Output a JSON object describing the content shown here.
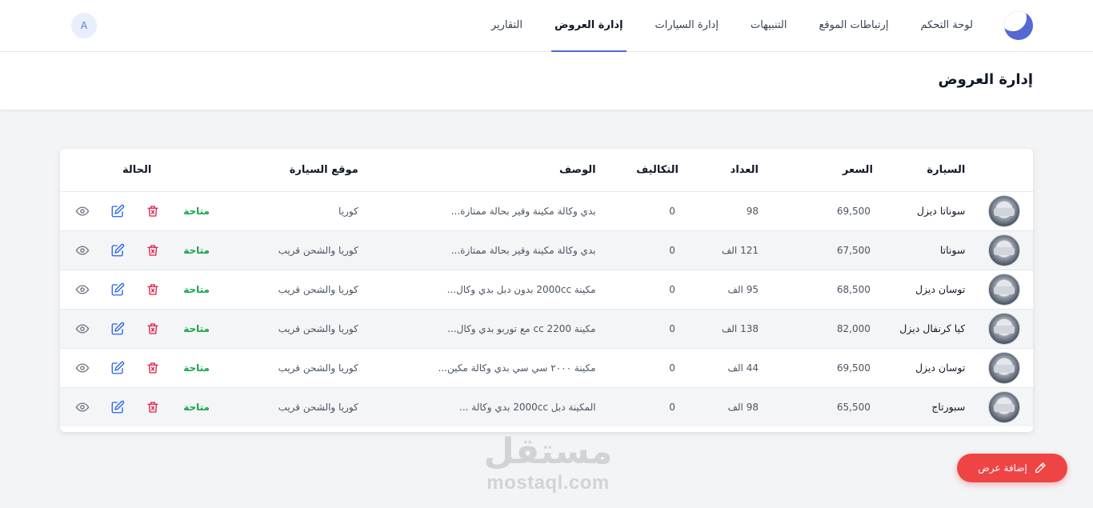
{
  "nav": {
    "items": [
      {
        "label": "لوحة التحكم",
        "active": false
      },
      {
        "label": "إرتباطات الموقع",
        "active": false
      },
      {
        "label": "التنبيهات",
        "active": false
      },
      {
        "label": "إدارة السيارات",
        "active": false
      },
      {
        "label": "إدارة العروض",
        "active": true
      },
      {
        "label": "التقارير",
        "active": false
      }
    ],
    "user_initial": "A",
    "logo_icon": "brand-logo-icon",
    "accent_color": "#5469d4"
  },
  "page": {
    "title": "إدارة العروض"
  },
  "table": {
    "headers": {
      "car": "السيارة",
      "price": "السعر",
      "odometer": "العداد",
      "costs": "التكاليف",
      "description": "الوصف",
      "location": "موقع السيارة",
      "status": "الحالة"
    },
    "rows": [
      {
        "car": "سوناتا ديزل",
        "price": "69,500",
        "odometer": "98",
        "costs": "0",
        "description": "بدي وكالة مكينة وقير بحالة ممتازة...",
        "location": "كوريا",
        "status": "متاحة"
      },
      {
        "car": "سوناتا",
        "price": "67,500",
        "odometer": "121 الف",
        "costs": "0",
        "description": "بدي وكالة مكينة وقير بحالة ممتازة...",
        "location": "كوريا والشحن قريب",
        "status": "متاحة"
      },
      {
        "car": "توسان ديزل",
        "price": "68,500",
        "odometer": "95 الف",
        "costs": "0",
        "description": "مكينة 2000cc بدون دبل بدي وكال...",
        "location": "كوريا والشحن قريب",
        "status": "متاحة"
      },
      {
        "car": "كيا كرنفال ديزل",
        "price": "82,000",
        "odometer": "138 الف",
        "costs": "0",
        "description": "مكينة 2200 cc مع توربو بدي وكال...",
        "location": "كوريا والشحن قريب",
        "status": "متاحة"
      },
      {
        "car": "توسان ديزل",
        "price": "69,500",
        "odometer": "44 الف",
        "costs": "0",
        "description": "مكينة ٢٠٠٠ سي سي بدي وكالة مكين...",
        "location": "كوريا والشحن قريب",
        "status": "متاحة"
      },
      {
        "car": "سبورتاج",
        "price": "65,500",
        "odometer": "98 الف",
        "costs": "0",
        "description": "المكينة دبل 2000cc بدي وكالة ...",
        "location": "كوريا والشحن قريب",
        "status": "متاحة"
      }
    ],
    "row_actions": [
      "trash-icon",
      "edit-icon",
      "eye-icon"
    ],
    "status_color": "#16a34a",
    "delete_color": "#e11d48",
    "edit_color": "#2563eb"
  },
  "fab": {
    "label": "إضافة عرض",
    "icon": "pencil-icon",
    "color": "#ef4444"
  },
  "watermark": {
    "arabic": "مستقل",
    "latin": "mostaql.com"
  }
}
